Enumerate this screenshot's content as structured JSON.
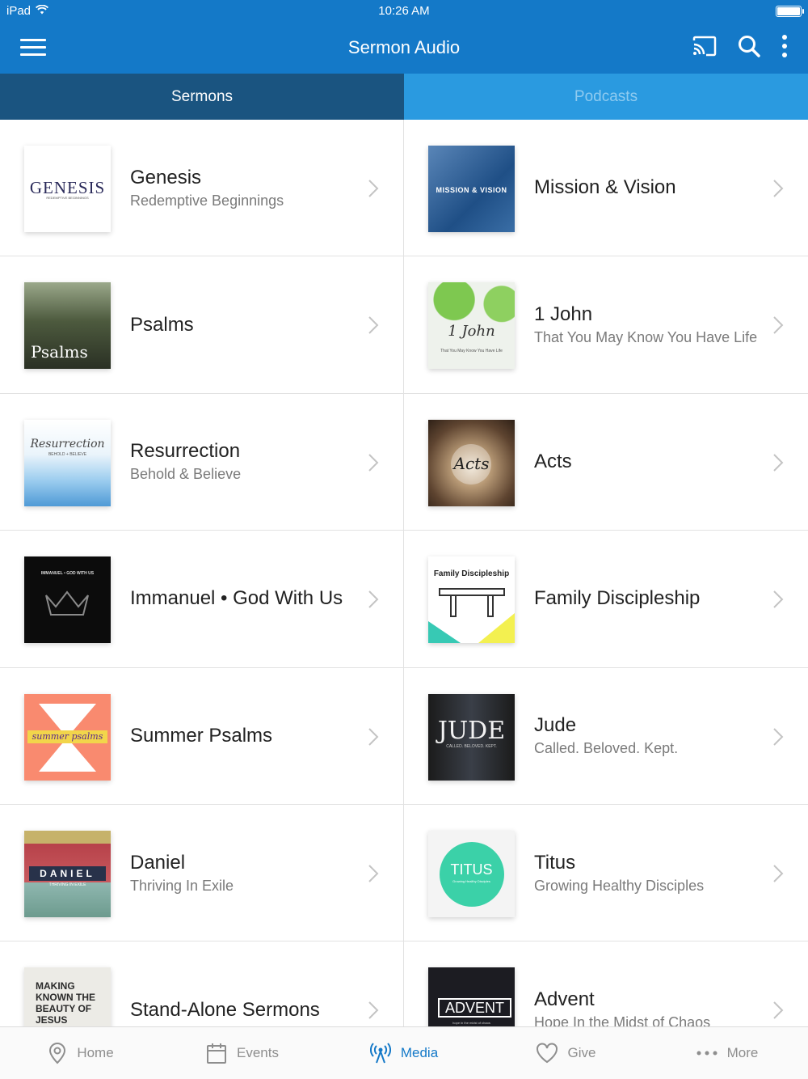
{
  "status": {
    "device": "iPad",
    "time": "10:26 AM"
  },
  "appbar": {
    "title": "Sermon Audio",
    "menu_icon": "hamburger-icon",
    "icons": [
      "cast-icon",
      "search-icon",
      "more-vertical-icon"
    ]
  },
  "tabs": [
    {
      "label": "Sermons",
      "active": true
    },
    {
      "label": "Podcasts",
      "active": false
    }
  ],
  "series": [
    {
      "title": "Genesis",
      "subtitle": "Redemptive Beginnings",
      "art": "GENESIS",
      "art_sub": "REDEMPTIVE BEGINNINGS"
    },
    {
      "title": "Mission & Vision",
      "subtitle": "",
      "art": "MISSION & VISION",
      "art_sub": ""
    },
    {
      "title": "Psalms",
      "subtitle": "",
      "art": "Psalms",
      "art_sub": ""
    },
    {
      "title": "1 John",
      "subtitle": "That You May Know You Have Life",
      "art": "1 John",
      "art_sub": "That You May Know You Have Life"
    },
    {
      "title": "Resurrection",
      "subtitle": "Behold & Believe",
      "art": "Resurrection",
      "art_sub": "BEHOLD + BELIEVE"
    },
    {
      "title": "Acts",
      "subtitle": "",
      "art": "Acts",
      "art_sub": ""
    },
    {
      "title": "Immanuel • God With Us",
      "subtitle": "",
      "art": "IMMANUEL • GOD WITH US",
      "art_sub": ""
    },
    {
      "title": "Family Discipleship",
      "subtitle": "",
      "art": "Family Discipleship",
      "art_sub": ""
    },
    {
      "title": "Summer Psalms",
      "subtitle": "",
      "art": "summer psalms",
      "art_sub": ""
    },
    {
      "title": "Jude",
      "subtitle": "Called. Beloved. Kept.",
      "art": "JUDE",
      "art_sub": "CALLED. BELOVED. KEPT."
    },
    {
      "title": "Daniel",
      "subtitle": "Thriving In Exile",
      "art": "DANIEL",
      "art_sub": "THRIVING IN EXILE"
    },
    {
      "title": "Titus",
      "subtitle": "Growing Healthy Disciples",
      "art": "TITUS",
      "art_sub": "Growing Healthy Disciples"
    },
    {
      "title": "Stand-Alone Sermons",
      "subtitle": "",
      "art": "MAKING KNOWN THE BEAUTY OF JESUS",
      "art_sub": ""
    },
    {
      "title": "Advent",
      "subtitle": "Hope In the Midst of Chaos",
      "art": "ADVENT",
      "art_sub": "hope in the midst of chaos"
    }
  ],
  "bottom_nav": [
    {
      "label": "Home",
      "icon": "location-pin-icon",
      "active": false
    },
    {
      "label": "Events",
      "icon": "calendar-icon",
      "active": false
    },
    {
      "label": "Media",
      "icon": "broadcast-icon",
      "active": true
    },
    {
      "label": "Give",
      "icon": "heart-icon",
      "active": false
    },
    {
      "label": "More",
      "icon": "ellipsis-icon",
      "active": false
    }
  ],
  "colors": {
    "brand": "#1479c8",
    "tab_active": "#1a5480",
    "tab_inactive": "#2a9ae0"
  }
}
